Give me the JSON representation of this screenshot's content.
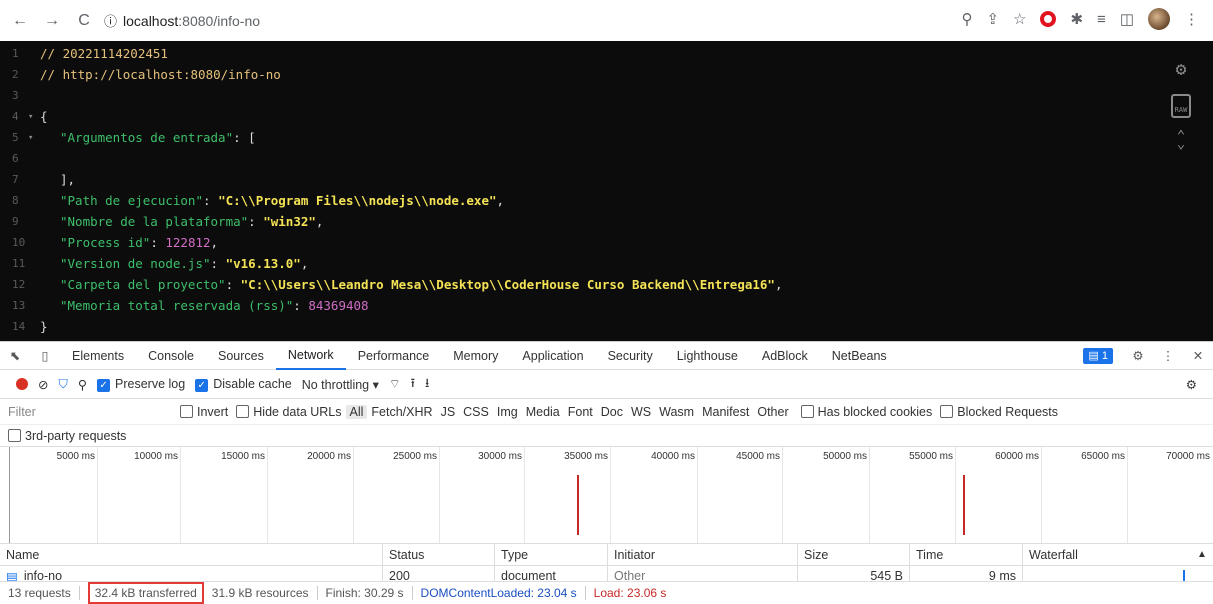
{
  "browser": {
    "url_host": "localhost",
    "url_rest": ":8080/info-no"
  },
  "code": {
    "lines": [
      {
        "n": "1",
        "text": "// 20221114202451"
      },
      {
        "n": "2",
        "text": "// http://localhost:8080/info-no"
      },
      {
        "n": "3"
      },
      {
        "n": "4",
        "text": "{"
      },
      {
        "n": "5",
        "key": "\"Argumentos de entrada\"",
        "rest": ": ["
      },
      {
        "n": "6"
      },
      {
        "n": "7",
        "text": "],"
      },
      {
        "n": "8",
        "key": "\"Path de ejecucion\"",
        "val": "\"C:\\\\Program Files\\\\nodejs\\\\node.exe\""
      },
      {
        "n": "9",
        "key": "\"Nombre de la plataforma\"",
        "val": "\"win32\""
      },
      {
        "n": "10",
        "key": "\"Process id\"",
        "num": "122812"
      },
      {
        "n": "11",
        "key": "\"Version de node.js\"",
        "val": "\"v16.13.0\""
      },
      {
        "n": "12",
        "key": "\"Carpeta del proyecto\"",
        "val": "\"C:\\\\Users\\\\Leandro Mesa\\\\Desktop\\\\CoderHouse Curso Backend\\\\Entrega16\""
      },
      {
        "n": "13",
        "key": "\"Memoria total reservada (rss)\"",
        "num": "84369408"
      },
      {
        "n": "14",
        "text": "}"
      }
    ],
    "raw_label": "RAW"
  },
  "devtools": {
    "tabs": [
      "Elements",
      "Console",
      "Sources",
      "Network",
      "Performance",
      "Memory",
      "Application",
      "Security",
      "Lighthouse",
      "AdBlock",
      "NetBeans"
    ],
    "issues_count": "1",
    "preserve_log": "Preserve log",
    "disable_cache": "Disable cache",
    "throttling": "No throttling",
    "filter_placeholder": "Filter",
    "invert": "Invert",
    "hide_data_urls": "Hide data URLs",
    "types": [
      "All",
      "Fetch/XHR",
      "JS",
      "CSS",
      "Img",
      "Media",
      "Font",
      "Doc",
      "WS",
      "Wasm",
      "Manifest",
      "Other"
    ],
    "blocked_cookies": "Has blocked cookies",
    "blocked_requests": "Blocked Requests",
    "third_party": "3rd-party requests",
    "ticks": [
      "5000 ms",
      "10000 ms",
      "15000 ms",
      "20000 ms",
      "25000 ms",
      "30000 ms",
      "35000 ms",
      "40000 ms",
      "45000 ms",
      "50000 ms",
      "55000 ms",
      "60000 ms",
      "65000 ms",
      "70000 ms"
    ],
    "columns": [
      "Name",
      "Status",
      "Type",
      "Initiator",
      "Size",
      "Time",
      "Waterfall"
    ],
    "row": {
      "name": "info-no",
      "status": "200",
      "type": "document",
      "initiator": "Other",
      "size": "545 B",
      "time": "9 ms"
    },
    "status": {
      "requests": "13 requests",
      "transferred": "32.4 kB transferred",
      "resources": "31.9 kB resources",
      "finish": "Finish: 30.29 s",
      "dcl": "DOMContentLoaded: 23.04 s",
      "load": "Load: 23.06 s"
    }
  }
}
